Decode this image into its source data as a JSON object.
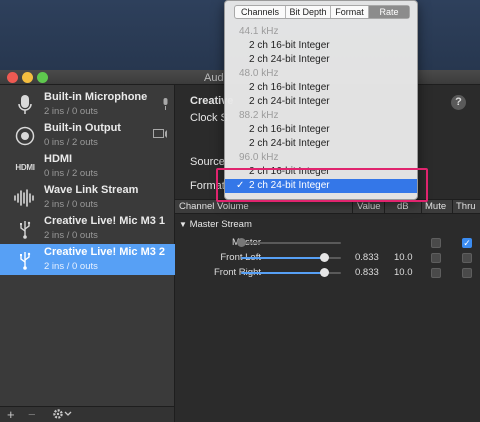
{
  "window": {
    "title": "Aud"
  },
  "sidebar": {
    "devices": [
      {
        "name": "Built-in Microphone",
        "io": "2 ins / 0 outs",
        "icon": "microphone-icon",
        "badge": "mic-icon"
      },
      {
        "name": "Built-in Output",
        "io": "0 ins / 2 outs",
        "icon": "speaker-icon",
        "badge": "screen-speaker-icon"
      },
      {
        "name": "HDMI",
        "io": "0 ins / 2 outs",
        "icon": "hdmi-icon"
      },
      {
        "name": "Wave Link Stream",
        "io": "2 ins / 0 outs",
        "icon": "waveform-icon"
      },
      {
        "name": "Creative Live! Mic M3 1",
        "io": "2 ins / 0 outs",
        "icon": "usb-icon"
      },
      {
        "name": "Creative Live! Mic M3 2",
        "io": "2 ins / 0 outs",
        "icon": "usb-icon",
        "selected": true
      }
    ],
    "add_label": "+",
    "remove_label": "−"
  },
  "main": {
    "device_title": "Creative",
    "clock_label": "Clock S",
    "source_label": "Source",
    "format_label": "Format",
    "help_label": "?"
  },
  "table": {
    "headers": {
      "channel_volume": "Channel Volume",
      "value": "Value",
      "db": "dB",
      "mute": "Mute",
      "thru": "Thru"
    },
    "group": "Master Stream",
    "rows": [
      {
        "label": "Master",
        "value": "",
        "db": "",
        "level": 0.0,
        "mute": false,
        "thru": true
      },
      {
        "label": "Front Left",
        "value": "0.833",
        "db": "10.0",
        "level": 0.833,
        "mute": false,
        "thru": false
      },
      {
        "label": "Front Right",
        "value": "0.833",
        "db": "10.0",
        "level": 0.833,
        "mute": false,
        "thru": false
      }
    ]
  },
  "popup": {
    "tabs": [
      "Channels",
      "Bit Depth",
      "Format",
      "Rate"
    ],
    "active_tab": "Rate",
    "items": [
      {
        "kind": "header",
        "text": "44.1 kHz"
      },
      {
        "kind": "option",
        "text": "2 ch 16-bit Integer"
      },
      {
        "kind": "option",
        "text": "2 ch 24-bit Integer"
      },
      {
        "kind": "header",
        "text": "48.0 kHz"
      },
      {
        "kind": "option",
        "text": "2 ch 16-bit Integer"
      },
      {
        "kind": "option",
        "text": "2 ch 24-bit Integer"
      },
      {
        "kind": "header",
        "text": "88.2 kHz"
      },
      {
        "kind": "option",
        "text": "2 ch 16-bit Integer"
      },
      {
        "kind": "option",
        "text": "2 ch 24-bit Integer"
      },
      {
        "kind": "header",
        "text": "96.0 kHz"
      },
      {
        "kind": "option",
        "text": "2 ch 16-bit Integer"
      },
      {
        "kind": "option",
        "text": "2 ch 24-bit Integer",
        "selected": true
      }
    ],
    "checkmark": "✓"
  },
  "colors": {
    "accent": "#57a0f5",
    "menu_selected": "#3477e8",
    "highlight": "#e0246e"
  }
}
